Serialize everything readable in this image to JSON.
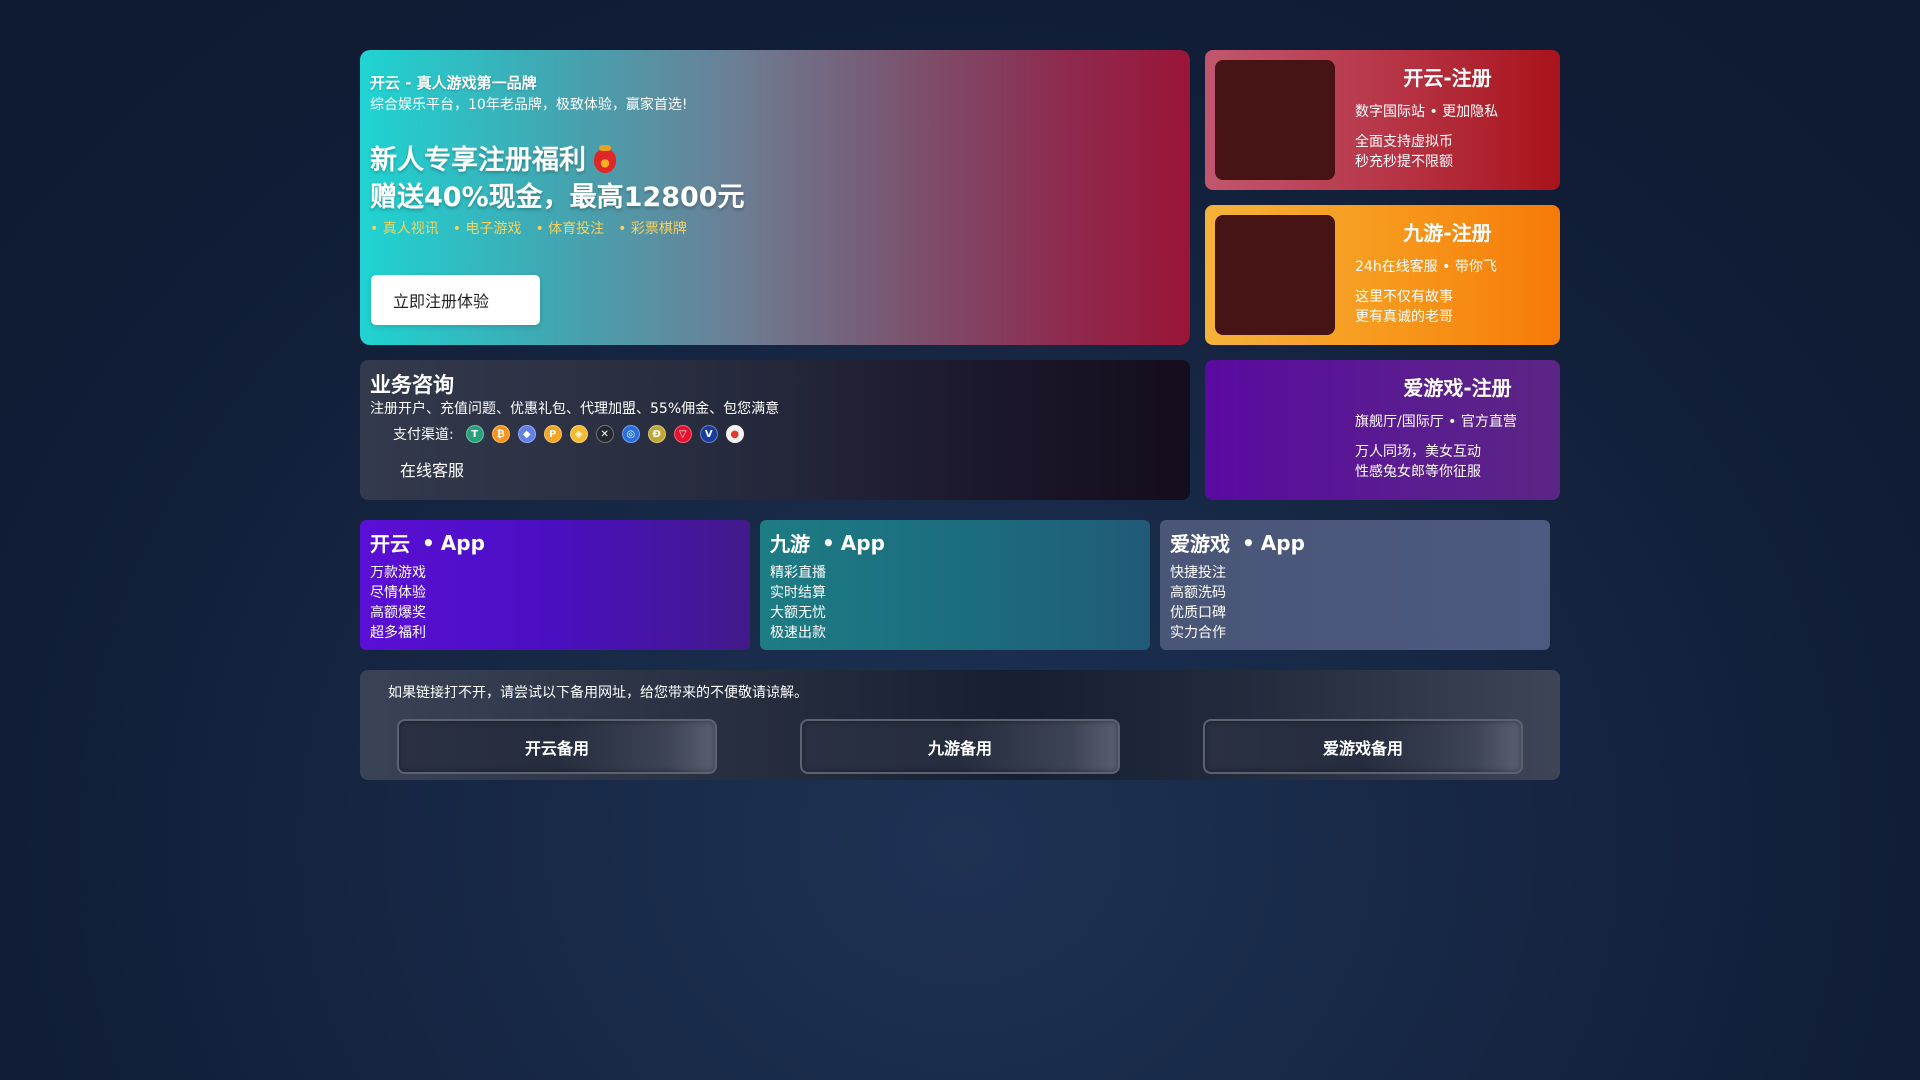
{
  "hero": {
    "brand": "开云 - 真人游戏第一品牌",
    "subtitle": "综合娱乐平台，10年老品牌，极致体验，赢家首选!",
    "headline1": "新人专享注册福利",
    "headline2": "赠送40%现金，最高12800元",
    "gift_icon": "red-envelope-icon",
    "tags": [
      "真人视讯",
      "电子游戏",
      "体育投注",
      "彩票棋牌"
    ],
    "tag_color": "#f4d35e",
    "cta_label": "立即注册体验"
  },
  "register_cards": [
    {
      "title": "开云-注册",
      "line1": "数字国际站 • 更加隐私",
      "line2": "全面支持虚拟币",
      "line3": "秒充秒提不限额"
    },
    {
      "title": "九游-注册",
      "line1": "24h在线客服 • 带你飞",
      "line2": "这里不仅有故事",
      "line3": "更有真诚的老哥"
    },
    {
      "title": "爱游戏-注册",
      "line1": "旗舰厅/国际厅 • 官方直营",
      "line2": "万人同场，美女互动",
      "line3": "性感兔女郎等你征服"
    }
  ],
  "consult": {
    "title": "业务咨询",
    "description": "注册开户、充值问题、优惠礼包、代理加盟、55%佣金、包您满意",
    "payment_label": "支付渠道:",
    "payment_icons": [
      {
        "name": "tether-icon",
        "glyph": "T",
        "color": "#26a17b"
      },
      {
        "name": "bitcoin-icon",
        "glyph": "₿",
        "color": "#f7931a"
      },
      {
        "name": "ethereum-icon",
        "glyph": "◆",
        "color": "#627eea"
      },
      {
        "name": "coin-orange-icon",
        "glyph": "P",
        "color": "#f5a623"
      },
      {
        "name": "bnb-icon",
        "glyph": "◈",
        "color": "#f3ba2f"
      },
      {
        "name": "xrp-icon",
        "glyph": "✕",
        "color": "#23292f"
      },
      {
        "name": "coin-blue-icon",
        "glyph": "◎",
        "color": "#2a6fdb"
      },
      {
        "name": "dogecoin-icon",
        "glyph": "Ð",
        "color": "#c2a633"
      },
      {
        "name": "tron-icon",
        "glyph": "▽",
        "color": "#e8112d"
      },
      {
        "name": "visa-icon",
        "glyph": "V",
        "color": "#1a3c9e"
      },
      {
        "name": "mastercard-icon",
        "glyph": "●",
        "color": "#f5f5f5"
      }
    ],
    "service_label": "在线客服"
  },
  "apps": [
    {
      "brand": "开云",
      "suffix": "App",
      "items": [
        "万款游戏",
        "尽情体验",
        "高额爆奖",
        "超多福利"
      ]
    },
    {
      "brand": "九游",
      "suffix": "App",
      "items": [
        "精彩直播",
        "实时结算",
        "大额无忧",
        "极速出款"
      ]
    },
    {
      "brand": "爱游戏",
      "suffix": "App",
      "items": [
        "快捷投注",
        "高额洗码",
        "优质口碑",
        "实力合作"
      ]
    }
  ],
  "backup": {
    "note": "如果链接打不开，请尝试以下备用网址，给您带来的不便敬请谅解。",
    "buttons": [
      "开云备用",
      "九游备用",
      "爱游戏备用"
    ]
  }
}
